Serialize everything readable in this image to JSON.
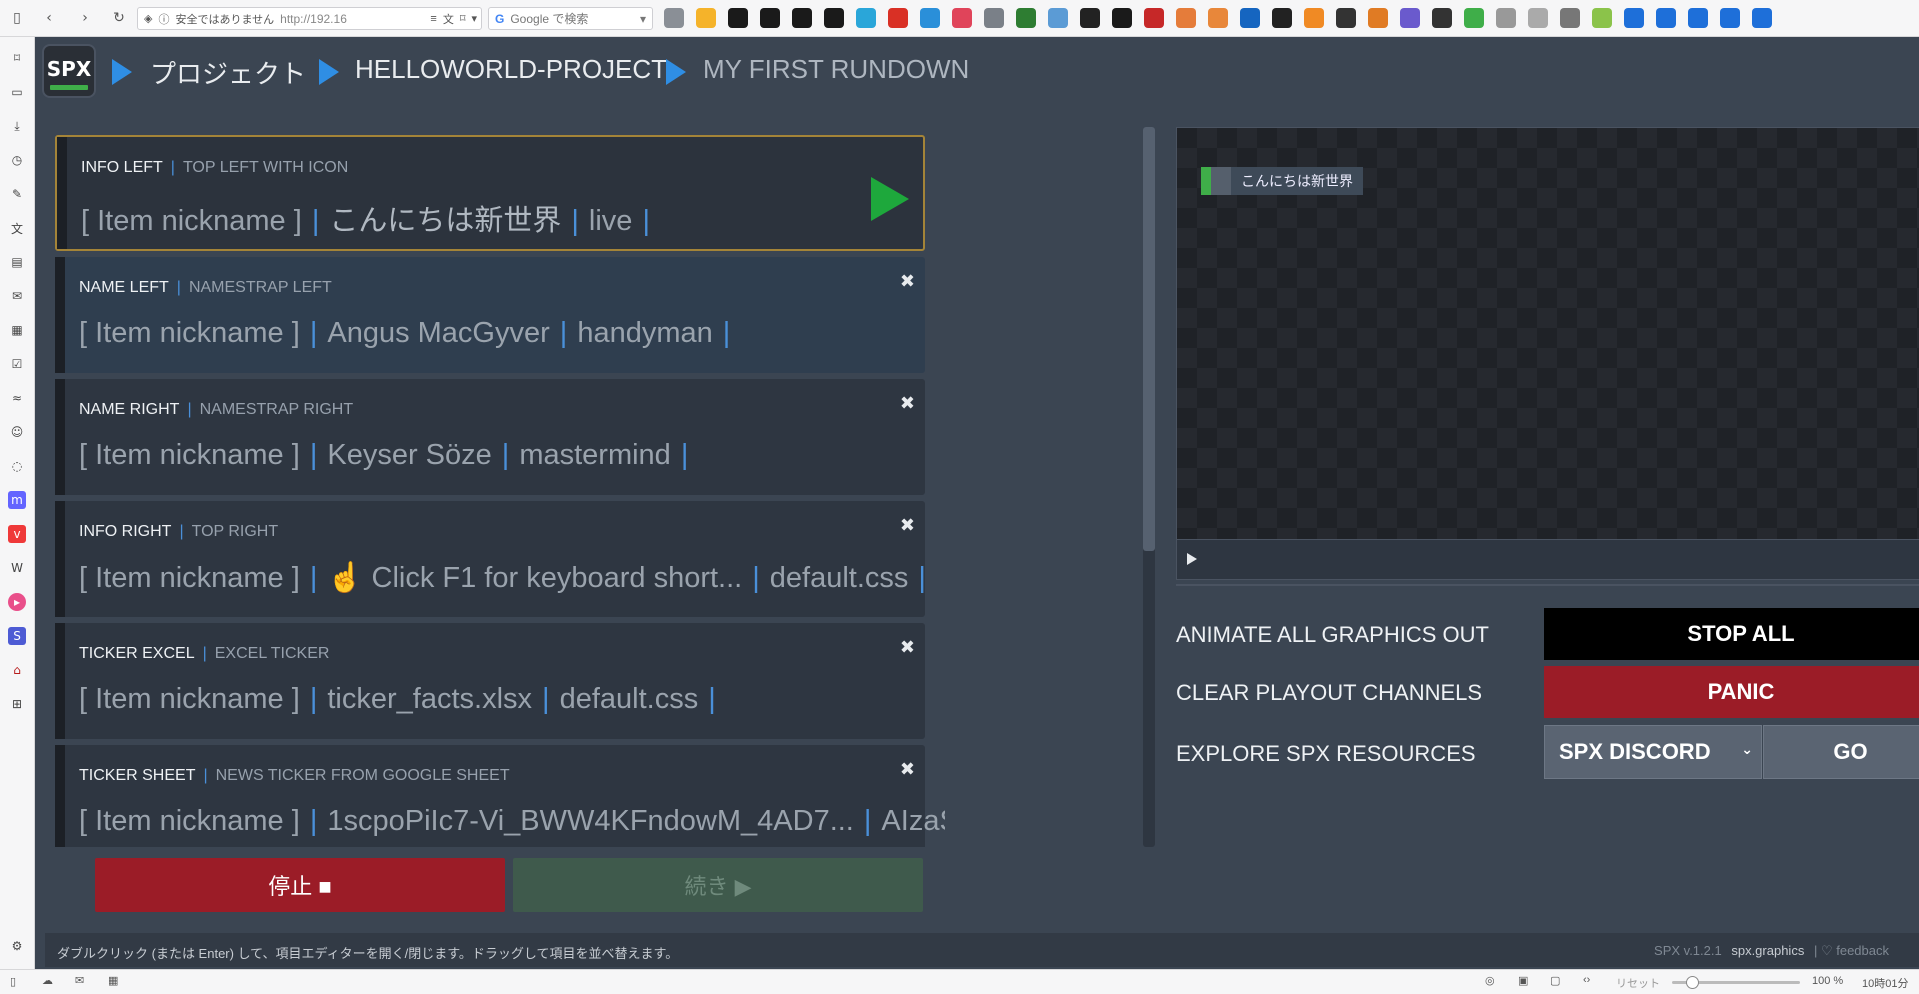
{
  "browser": {
    "security_label": "安全ではありません",
    "url": "http://192.16",
    "search_placeholder": "Google で検索"
  },
  "header": {
    "logo": "SPX",
    "breadcrumbs": [
      "プロジェクト",
      "HELLOWORLD-PROJECT",
      "MY FIRST RUNDOWN"
    ]
  },
  "rundown": {
    "items": [
      {
        "title": "INFO LEFT",
        "subtitle": "TOP LEFT WITH ICON",
        "nickname": "[ Item nickname ]",
        "field1": "こんにちは新世界",
        "field2": "live"
      },
      {
        "title": "NAME LEFT",
        "subtitle": "NAMESTRAP LEFT",
        "nickname": "[ Item nickname ]",
        "field1": "Angus MacGyver",
        "field2": "handyman"
      },
      {
        "title": "NAME RIGHT",
        "subtitle": "NAMESTRAP RIGHT",
        "nickname": "[ Item nickname ]",
        "field1": "Keyser Söze",
        "field2": "mastermind"
      },
      {
        "title": "INFO RIGHT",
        "subtitle": "TOP RIGHT",
        "nickname": "[ Item nickname ]",
        "field1": "☝ Click F1 for keyboard short...",
        "field2": "default.css"
      },
      {
        "title": "TICKER EXCEL",
        "subtitle": "EXCEL TICKER",
        "nickname": "[ Item nickname ]",
        "field1": "ticker_facts.xlsx",
        "field2": "default.css"
      },
      {
        "title": "TICKER SHEET",
        "subtitle": "NEWS TICKER FROM GOOGLE SHEET",
        "nickname": "[ Item nickname ]",
        "field1": "1scpoPiIc7-Vi_BWW4KFndowM_4AD7...",
        "field2": "AIzaSyB..."
      }
    ]
  },
  "buttons": {
    "stop": "停止 ■",
    "continue": "続き ▶"
  },
  "preview": {
    "graphic_text": "こんにちは新世界"
  },
  "controls": {
    "animate_out_label": "ANIMATE ALL GRAPHICS OUT",
    "stop_all": "STOP ALL",
    "clear_label": "CLEAR PLAYOUT CHANNELS",
    "panic": "PANIC",
    "explore_label": "EXPLORE SPX RESOURCES",
    "resource_selected": "SPX DISCORD",
    "go": "GO"
  },
  "footer": {
    "help": "ダブルクリック (または Enter) して、項目エディターを開く/閉じます。ドラッグして項目を並べ替えます。",
    "version": "SPX v.1.2.1",
    "site": "spx.graphics",
    "feedback": "♡ feedback"
  },
  "status_bar": {
    "reset": "リセット",
    "zoom": "100 %",
    "time": "10時01分"
  },
  "colors": {
    "accent_blue": "#2f8ee4",
    "panic_red": "#9b1c27",
    "play_green": "#1ea83c",
    "selected_border": "#a48438"
  }
}
